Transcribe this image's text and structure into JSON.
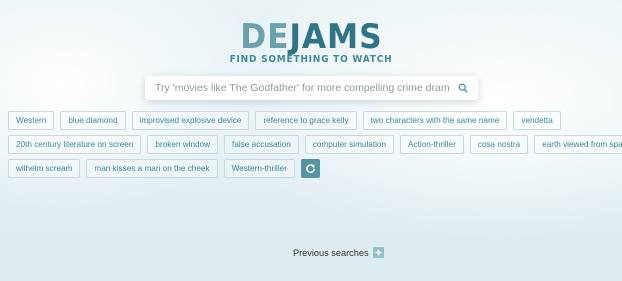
{
  "logo": {
    "part1": "DE",
    "part2": "JAMS",
    "tagline": "FIND SOMETHING TO WATCH"
  },
  "search": {
    "placeholder": "Try 'movies like The Godfather' for more compelling crime dramas",
    "value": "",
    "icon": "search-icon"
  },
  "tags": {
    "row1": [
      "Western",
      "blue diamond",
      "improvised explosive device",
      "reference to grace kelly",
      "two characters with the same name",
      "vendetta"
    ],
    "row2": [
      "20th century literature on screen",
      "broken window",
      "false accusation",
      "computer simulation",
      "Action-thriller",
      "cosa nostra",
      "earth viewed from space"
    ],
    "row3": [
      "wilhelm scream",
      "man kisses a man on the cheek",
      "Western-thriller"
    ],
    "refresh_icon": "refresh-icon"
  },
  "previous_searches": {
    "label": "Previous searches",
    "icon": "plus-icon"
  },
  "colors": {
    "accent": "#3b8a98",
    "logo_light": "#6aa1ad",
    "logo_dark": "#2f7587",
    "refresh_bg": "#55959f"
  }
}
